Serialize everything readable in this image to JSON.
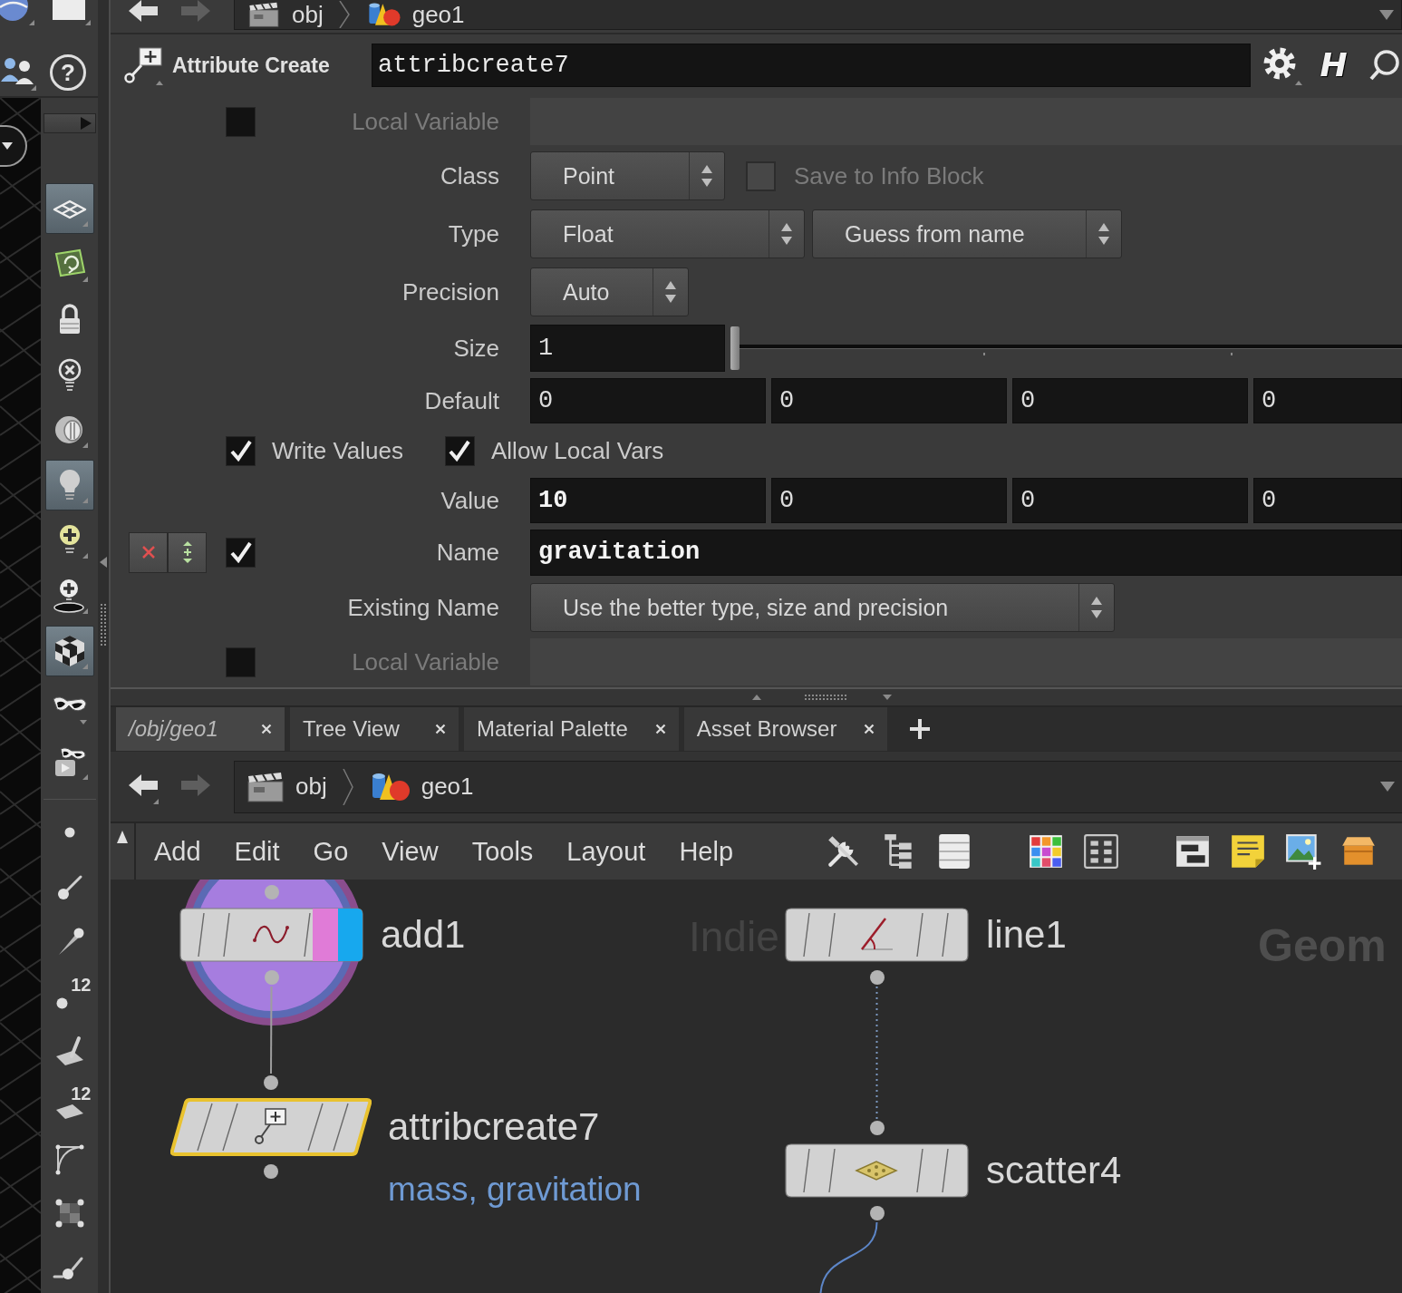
{
  "top_path": {
    "back_disabled": false,
    "forward_disabled": true,
    "segments": [
      {
        "label": "obj"
      },
      {
        "label": "geo1"
      }
    ]
  },
  "left_corner": {
    "help": "?"
  },
  "shelf": [
    {
      "on": true
    },
    {
      "on": false
    },
    {
      "on": false
    },
    {
      "on": false
    },
    {
      "on": false
    },
    {
      "on": true
    },
    {
      "on": false
    },
    {
      "on": false
    },
    {
      "on": true
    },
    {
      "on": false
    },
    {
      "on": false
    },
    {
      "on": false
    },
    {
      "on": false
    },
    {
      "on": false
    },
    {
      "on": false,
      "badge": "12"
    },
    {
      "on": false
    },
    {
      "on": false,
      "badge": "12"
    },
    {
      "on": false
    },
    {
      "on": false
    },
    {
      "on": false
    }
  ],
  "parameter_header": {
    "node_type": "Attribute Create",
    "node_name": "attribcreate7",
    "help_button": "H"
  },
  "parameters": [
    {
      "kind": "local_variable",
      "label": "Local Variable",
      "disabled": true,
      "checked": false
    },
    {
      "kind": "menu",
      "label": "Class",
      "menus": [
        "Point"
      ],
      "toggle": {
        "label": "Save to Info Block",
        "checked": false,
        "disabled": true
      }
    },
    {
      "kind": "menu",
      "label": "Type",
      "menus": [
        "Float",
        "Guess from name"
      ]
    },
    {
      "kind": "menu",
      "label": "Precision",
      "menus": [
        "Auto"
      ]
    },
    {
      "kind": "slider",
      "label": "Size",
      "value": "1",
      "level": 0
    },
    {
      "kind": "vector",
      "label": "Default",
      "values": [
        {
          "text": "0",
          "modified": false
        },
        {
          "text": "0",
          "modified": false
        },
        {
          "text": "0",
          "modified": false
        },
        {
          "text": "0",
          "modified": false
        }
      ]
    },
    {
      "kind": "toggles",
      "toggles": [
        {
          "label": "Write Values",
          "checked": true
        },
        {
          "label": "Allow Local Vars",
          "checked": true
        }
      ]
    },
    {
      "kind": "vector",
      "label": "Value",
      "values": [
        {
          "text": "10",
          "modified": true
        },
        {
          "text": "0",
          "modified": false
        },
        {
          "text": "0",
          "modified": false
        },
        {
          "text": "0",
          "modified": false
        }
      ]
    },
    {
      "kind": "name",
      "label": "Name",
      "value": "gravitation",
      "modified": true,
      "checked": true
    },
    {
      "kind": "menu",
      "label": "Existing Name",
      "menus": [
        "Use the better type, size and precision"
      ]
    },
    {
      "kind": "local_variable",
      "label": "Local Variable",
      "disabled": true,
      "checked": false
    }
  ],
  "tabs": [
    {
      "label": "/obj/geo1",
      "kind": "network",
      "selected": true
    },
    {
      "label": "Tree View",
      "kind": "pane",
      "selected": false
    },
    {
      "label": "Material Palette",
      "kind": "pane",
      "selected": false
    },
    {
      "label": "Asset Browser",
      "kind": "pane",
      "selected": false
    }
  ],
  "path_bar": {
    "back_disabled": false,
    "forward_disabled": true,
    "segments": [
      {
        "label": "obj"
      },
      {
        "label": "geo1"
      }
    ]
  },
  "menu": [
    "Add",
    "Edit",
    "Go",
    "View",
    "Tools",
    "Layout",
    "Help"
  ],
  "network": {
    "background_labels": [
      "Indie",
      "Geom"
    ],
    "nodes": [
      {
        "name": "add1",
        "selected": false,
        "render": true,
        "display": true
      },
      {
        "name": "attribcreate7",
        "selected": true,
        "render": false,
        "display": false,
        "comment": "mass, gravitation"
      },
      {
        "name": "line1",
        "selected": false,
        "render": false,
        "display": false
      },
      {
        "name": "scatter4",
        "selected": false,
        "render": false,
        "display": false
      }
    ]
  }
}
